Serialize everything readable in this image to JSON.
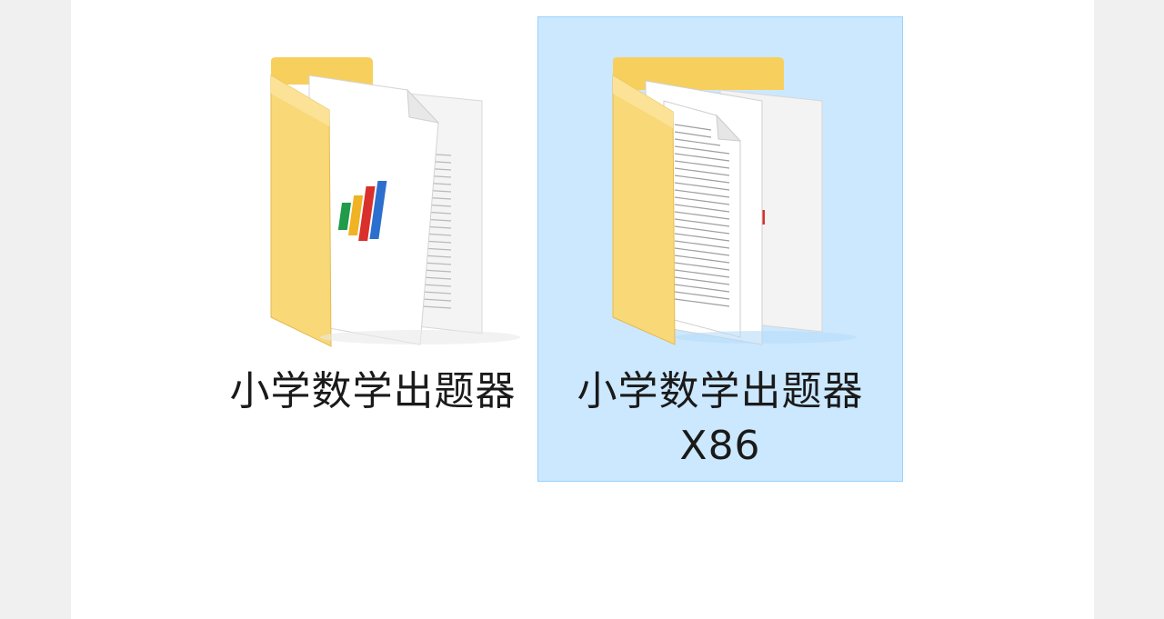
{
  "explorer": {
    "items": [
      {
        "name": "小学数学出题器",
        "selected": false,
        "icon": "folder-with-app-icon"
      },
      {
        "name_line1": "小学数学出题器",
        "name_line2": "X86",
        "selected": true,
        "icon": "folder-with-documents-icon"
      }
    ],
    "colors": {
      "selection_bg": "#cce8ff",
      "selection_border": "#99d1ff",
      "folder_yellow": "#f8d775",
      "folder_dark": "#e9b949"
    }
  }
}
